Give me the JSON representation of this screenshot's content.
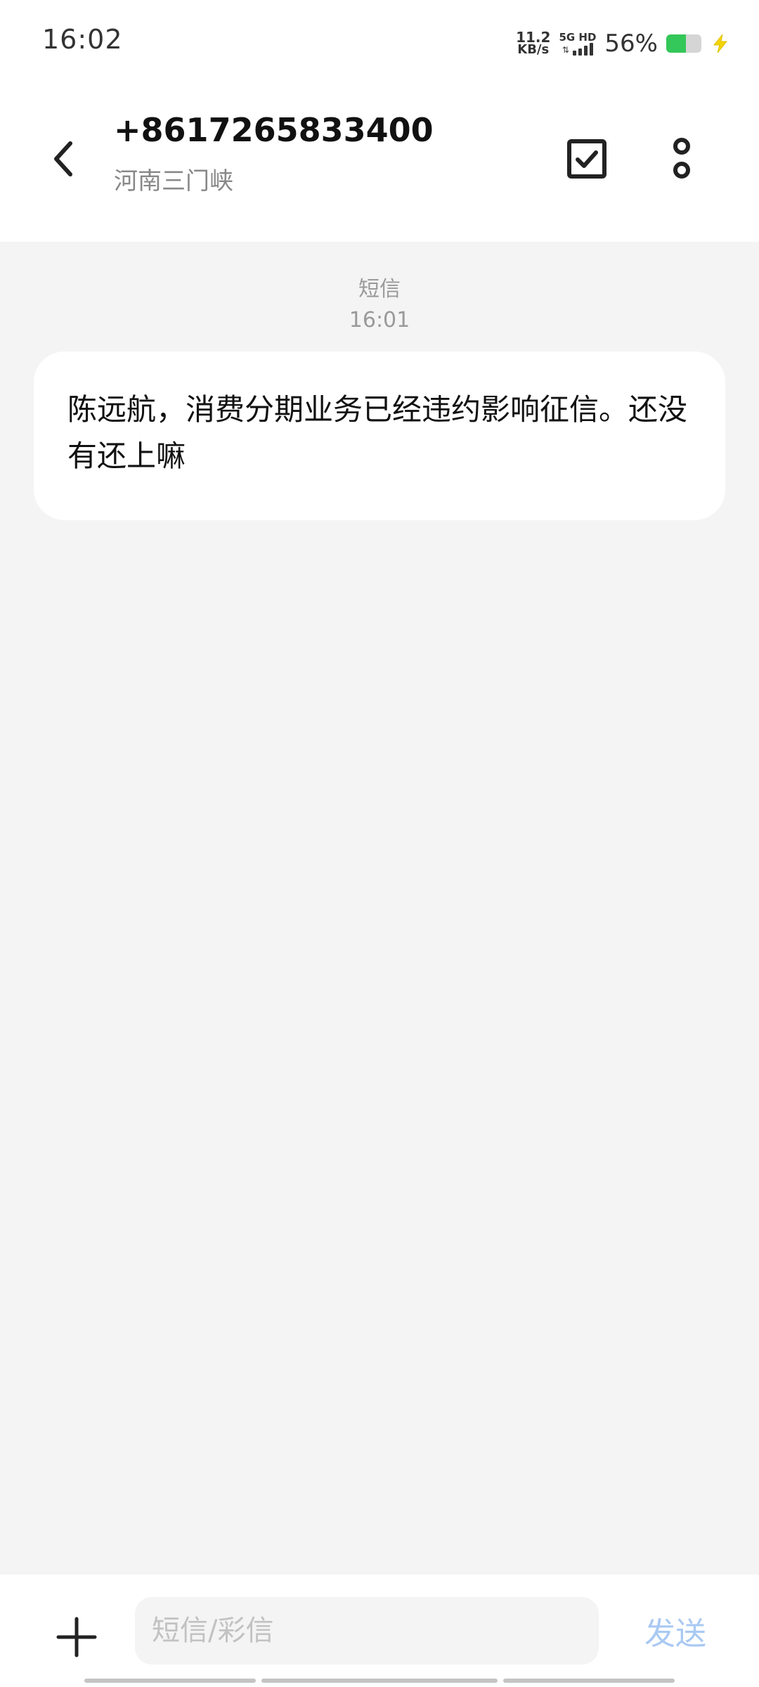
{
  "status_bar": {
    "time": "16:02",
    "net_speed_value": "11.2",
    "net_speed_unit": "KB/s",
    "network_label": "5G HD",
    "battery_percent": "56%",
    "battery_level": 0.56,
    "charging": true
  },
  "header": {
    "contact_number": "+8617265833400",
    "contact_location": "河南三门峡",
    "icons": {
      "back": "chevron-left-icon",
      "select": "checkbox-icon",
      "more": "more-vertical-icon"
    }
  },
  "conversation": {
    "messages": [
      {
        "type": "短信",
        "time": "16:01",
        "text": "陈远航，消费分期业务已经违约影响征信。还没有还上嘛"
      }
    ]
  },
  "input_bar": {
    "placeholder": "短信/彩信",
    "value": "",
    "send_label": "发送",
    "send_color": "#a9c9f3",
    "icons": {
      "add": "plus-icon"
    }
  },
  "colors": {
    "accent": "#a9c9f3",
    "battery_green": "#34c759",
    "charging_bolt": "#f4d400"
  }
}
